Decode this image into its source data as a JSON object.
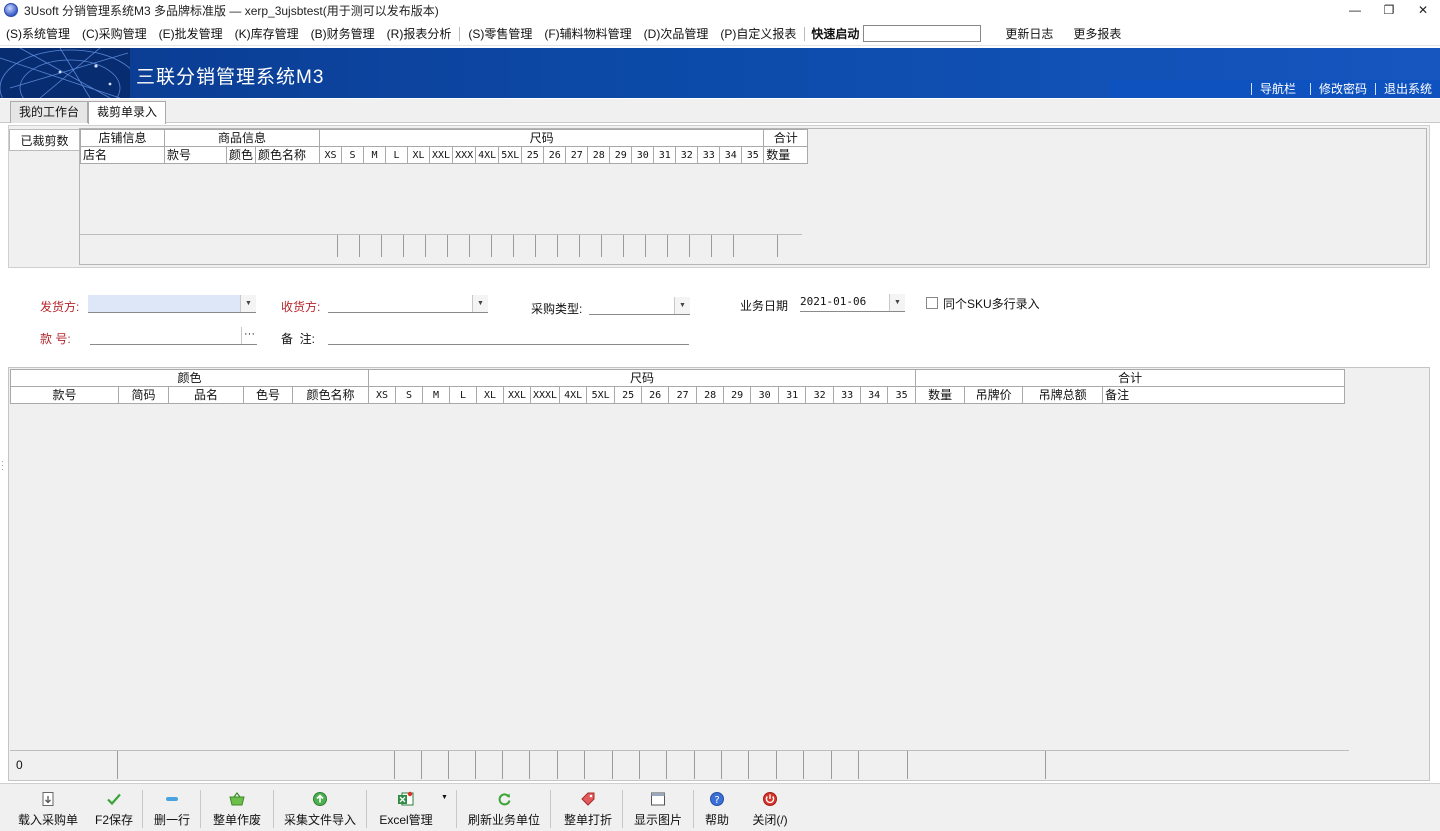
{
  "window": {
    "title": "3Usoft 分销管理系统M3 多品牌标准版 — xerp_3ujsbtest(用于测可以发布版本)",
    "minimize": "—",
    "restore": "❐",
    "close": "✕"
  },
  "menu": {
    "items": [
      "(S)系统管理",
      "(C)采购管理",
      "(E)批发管理",
      "(K)库存管理",
      "(B)财务管理",
      "(R)报表分析",
      "(S)零售管理",
      "(F)辅料物料管理",
      "(D)次品管理",
      "(P)自定义报表"
    ],
    "quick_launch_label": "快速启动",
    "quick_launch_value": "",
    "update_log": "更新日志",
    "more_reports": "更多报表"
  },
  "banner": {
    "system_title": "三联分销管理系统M3",
    "nav": "导航栏",
    "change_password": "修改密码",
    "exit": "退出系统"
  },
  "tabs": [
    {
      "label": "我的工作台",
      "active": false
    },
    {
      "label": "裁剪单录入",
      "active": true
    }
  ],
  "top_panel": {
    "side_tab": "已裁剪数",
    "group_headers": {
      "store": "店铺信息",
      "product": "商品信息",
      "size": "尺码",
      "total": "合计"
    },
    "columns": {
      "store_name": "店名",
      "style_no": "款号",
      "color": "颜色",
      "color_name": "颜色名称",
      "sizes": [
        "XS",
        "S",
        "M",
        "L",
        "XL",
        "XXL",
        "XXX",
        "4XL",
        "5XL",
        "25",
        "26",
        "27",
        "28",
        "29",
        "30",
        "31",
        "32",
        "33",
        "34",
        "35"
      ],
      "qty": "数量"
    }
  },
  "form": {
    "shipper_label": "发货方:",
    "shipper_value": "",
    "receiver_label": "收货方:",
    "receiver_value": "",
    "purchase_type_label": "采购类型:",
    "purchase_type_value": "",
    "biz_date_label": "业务日期",
    "biz_date_value": "2021-01-06",
    "same_sku_label": "同个SKU多行录入",
    "same_sku_checked": false,
    "style_no_label": "款 号:",
    "style_no_value": "",
    "ellipsis": "···",
    "remark_label": "备  注:",
    "remark_value": ""
  },
  "main_grid": {
    "group_headers": {
      "color": "颜色",
      "size": "尺码",
      "total": "合计"
    },
    "columns": {
      "style_no": "款号",
      "short_code": "简码",
      "product_name": "品名",
      "color_no": "色号",
      "color_name": "颜色名称",
      "sizes": [
        "XS",
        "S",
        "M",
        "L",
        "XL",
        "XXL",
        "XXXL",
        "4XL",
        "5XL",
        "25",
        "26",
        "27",
        "28",
        "29",
        "30",
        "31",
        "32",
        "33",
        "34",
        "35"
      ],
      "qty": "数量",
      "tag_price": "吊牌价",
      "tag_total": "吊牌总额",
      "remark": "备注"
    },
    "footer_count": "0"
  },
  "toolbar": {
    "load_po": "载入采购单",
    "f2_save": "F2保存",
    "delete_row": "删一行",
    "void_order": "整单作废",
    "import_file": "采集文件导入",
    "excel": "Excel管理",
    "refresh_units": "刷新业务单位",
    "discount": "整单打折",
    "show_image": "显示图片",
    "help": "帮助",
    "close": "关闭(/)"
  },
  "colors": {
    "banner_blue": "#0c4aa8",
    "label_red": "#b3262b",
    "save_green": "#3aa535",
    "help_blue": "#3b6fd6",
    "close_red": "#d9342b"
  }
}
